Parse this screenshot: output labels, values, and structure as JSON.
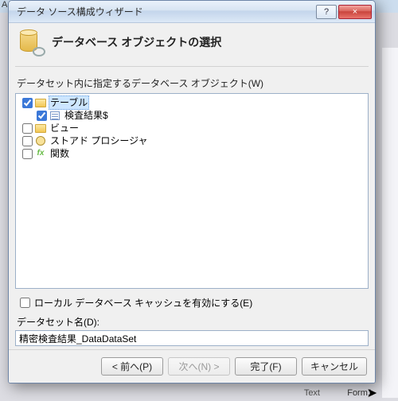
{
  "bg": {
    "topLeft": "Act",
    "bottomText": "Text",
    "bottomForm": "Form1"
  },
  "window": {
    "title": "データ ソース構成ウィザード",
    "help": "?",
    "close": "×"
  },
  "header": {
    "title": "データベース オブジェクトの選択"
  },
  "labels": {
    "treePrompt": "データセット内に指定するデータベース オブジェクト(W)",
    "localCache": "ローカル データベース キャッシュを有効にする(E)",
    "datasetName": "データセット名(D):"
  },
  "tree": {
    "tables": {
      "label": "テーブル",
      "checked": true
    },
    "sheet": {
      "label": "検査結果$",
      "checked": true
    },
    "views": {
      "label": "ビュー",
      "checked": false
    },
    "sprocs": {
      "label": "ストアド プロシージャ",
      "checked": false
    },
    "funcs": {
      "label": "関数",
      "checked": false
    }
  },
  "localCacheChecked": false,
  "datasetName": "精密検査結果_DataDataSet",
  "buttons": {
    "back": "< 前へ(P)",
    "next": "次へ(N) >",
    "finish": "完了(F)",
    "cancel": "キャンセル"
  }
}
